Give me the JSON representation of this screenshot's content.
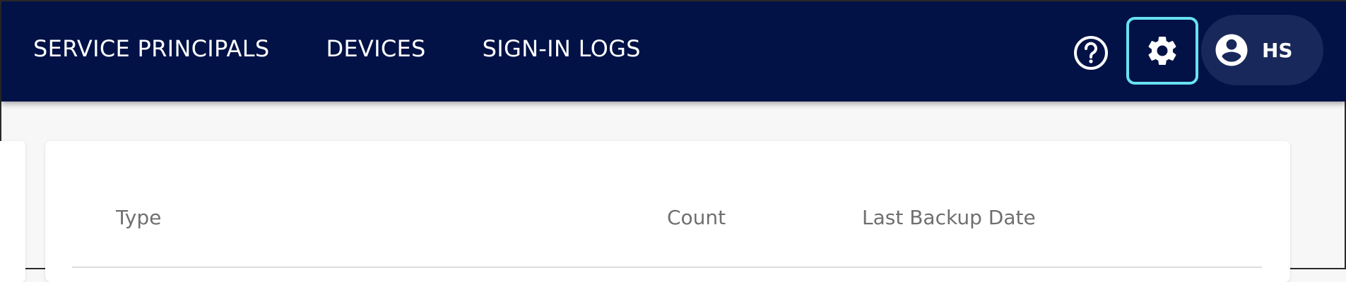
{
  "header": {
    "nav": [
      {
        "label": "SERVICE PRINCIPALS"
      },
      {
        "label": "DEVICES"
      },
      {
        "label": "SIGN-IN LOGS"
      }
    ],
    "help_icon": "help-circle-icon",
    "settings_icon": "gear-icon",
    "user": {
      "initials": "HS",
      "icon": "account-circle-icon"
    }
  },
  "table": {
    "columns": [
      "Type",
      "Count",
      "Last Backup Date"
    ]
  },
  "colors": {
    "topbar": "#021246",
    "user_pill": "#18285a",
    "focus_ring": "#68e1f2",
    "header_text": "#6f6f6f"
  }
}
